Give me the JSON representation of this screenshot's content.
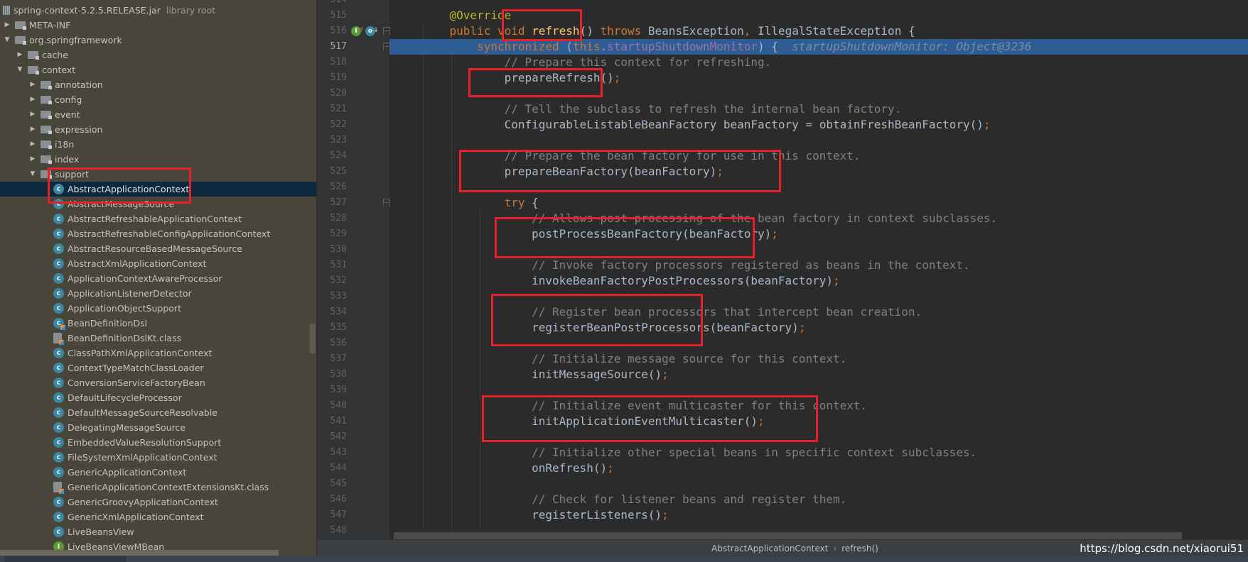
{
  "project_tree": {
    "root": {
      "label": "spring-context-5.2.5.RELEASE.jar",
      "sublabel": "library root",
      "icon": "jar-icon"
    },
    "items": [
      {
        "label": "META-INF",
        "depth": 0,
        "type": "folder",
        "expanded": false
      },
      {
        "label": "org.springframework",
        "depth": 0,
        "type": "folder",
        "expanded": true
      },
      {
        "label": "cache",
        "depth": 1,
        "type": "folder",
        "expanded": false
      },
      {
        "label": "context",
        "depth": 1,
        "type": "folder",
        "expanded": true
      },
      {
        "label": "annotation",
        "depth": 2,
        "type": "folder",
        "expanded": false
      },
      {
        "label": "config",
        "depth": 2,
        "type": "folder",
        "expanded": false
      },
      {
        "label": "event",
        "depth": 2,
        "type": "folder",
        "expanded": false
      },
      {
        "label": "expression",
        "depth": 2,
        "type": "folder",
        "expanded": false
      },
      {
        "label": "i18n",
        "depth": 2,
        "type": "folder",
        "expanded": false
      },
      {
        "label": "index",
        "depth": 2,
        "type": "folder",
        "expanded": false
      },
      {
        "label": "support",
        "depth": 2,
        "type": "folder",
        "expanded": true
      },
      {
        "label": "AbstractApplicationContext",
        "depth": 3,
        "type": "class",
        "selected": true
      },
      {
        "label": "AbstractMessageSource",
        "depth": 3,
        "type": "class"
      },
      {
        "label": "AbstractRefreshableApplicationContext",
        "depth": 3,
        "type": "class"
      },
      {
        "label": "AbstractRefreshableConfigApplicationContext",
        "depth": 3,
        "type": "class"
      },
      {
        "label": "AbstractResourceBasedMessageSource",
        "depth": 3,
        "type": "class"
      },
      {
        "label": "AbstractXmlApplicationContext",
        "depth": 3,
        "type": "class"
      },
      {
        "label": "ApplicationContextAwareProcessor",
        "depth": 3,
        "type": "class"
      },
      {
        "label": "ApplicationListenerDetector",
        "depth": 3,
        "type": "class"
      },
      {
        "label": "ApplicationObjectSupport",
        "depth": 3,
        "type": "class"
      },
      {
        "label": "BeanDefinitionDsl",
        "depth": 3,
        "type": "kotlin-class"
      },
      {
        "label": "BeanDefinitionDslKt.class",
        "depth": 3,
        "type": "kotlin-file"
      },
      {
        "label": "ClassPathXmlApplicationContext",
        "depth": 3,
        "type": "class"
      },
      {
        "label": "ContextTypeMatchClassLoader",
        "depth": 3,
        "type": "class"
      },
      {
        "label": "ConversionServiceFactoryBean",
        "depth": 3,
        "type": "class"
      },
      {
        "label": "DefaultLifecycleProcessor",
        "depth": 3,
        "type": "class"
      },
      {
        "label": "DefaultMessageSourceResolvable",
        "depth": 3,
        "type": "class"
      },
      {
        "label": "DelegatingMessageSource",
        "depth": 3,
        "type": "class"
      },
      {
        "label": "EmbeddedValueResolutionSupport",
        "depth": 3,
        "type": "class"
      },
      {
        "label": "FileSystemXmlApplicationContext",
        "depth": 3,
        "type": "class"
      },
      {
        "label": "GenericApplicationContext",
        "depth": 3,
        "type": "class"
      },
      {
        "label": "GenericApplicationContextExtensionsKt.class",
        "depth": 3,
        "type": "kotlin-file"
      },
      {
        "label": "GenericGroovyApplicationContext",
        "depth": 3,
        "type": "class"
      },
      {
        "label": "GenericXmlApplicationContext",
        "depth": 3,
        "type": "class"
      },
      {
        "label": "LiveBeansView",
        "depth": 3,
        "type": "class"
      },
      {
        "label": "LiveBeansViewMBean",
        "depth": 3,
        "type": "interface"
      }
    ]
  },
  "editor": {
    "partial_top_line": "514",
    "current_line": "517",
    "lines": [
      {
        "num": "515",
        "tokens": [
          {
            "t": "    ",
            "c": "plain"
          },
          {
            "t": "@Override",
            "c": "ann"
          }
        ]
      },
      {
        "num": "516",
        "tokens": [
          {
            "t": "    ",
            "c": "plain"
          },
          {
            "t": "public void ",
            "c": "kw"
          },
          {
            "t": "refresh",
            "c": "fn"
          },
          {
            "t": "() ",
            "c": "plain"
          },
          {
            "t": "throws ",
            "c": "kw"
          },
          {
            "t": "BeansException",
            "c": "plain"
          },
          {
            "t": ", ",
            "c": "kw"
          },
          {
            "t": "IllegalStateException {",
            "c": "plain"
          }
        ]
      },
      {
        "num": "517",
        "tokens": [
          {
            "t": "        ",
            "c": "plain"
          },
          {
            "t": "synchronized ",
            "c": "kw"
          },
          {
            "t": "(",
            "c": "plain"
          },
          {
            "t": "this",
            "c": "kw"
          },
          {
            "t": ".",
            "c": "plain"
          },
          {
            "t": "startupShutdownMonitor",
            "c": "field"
          },
          {
            "t": ") {  ",
            "c": "plain"
          },
          {
            "t": "startupShutdownMonitor: Object@3236",
            "c": "hint"
          }
        ]
      },
      {
        "num": "518",
        "tokens": [
          {
            "t": "            ",
            "c": "plain"
          },
          {
            "t": "// Prepare this context for refreshing.",
            "c": "cm"
          }
        ]
      },
      {
        "num": "519",
        "tokens": [
          {
            "t": "            prepareRefresh()",
            "c": "plain"
          },
          {
            "t": ";",
            "c": "semi"
          }
        ]
      },
      {
        "num": "520",
        "tokens": []
      },
      {
        "num": "521",
        "tokens": [
          {
            "t": "            ",
            "c": "plain"
          },
          {
            "t": "// Tell the subclass to refresh the internal bean factory.",
            "c": "cm"
          }
        ]
      },
      {
        "num": "522",
        "tokens": [
          {
            "t": "            ConfigurableListableBeanFactory beanFactory = obtainFreshBeanFactory()",
            "c": "plain"
          },
          {
            "t": ";",
            "c": "semi"
          }
        ]
      },
      {
        "num": "523",
        "tokens": []
      },
      {
        "num": "524",
        "tokens": [
          {
            "t": "            ",
            "c": "plain"
          },
          {
            "t": "// Prepare the bean factory for use in this context.",
            "c": "cm"
          }
        ]
      },
      {
        "num": "525",
        "tokens": [
          {
            "t": "            prepareBeanFactory(beanFactory)",
            "c": "plain"
          },
          {
            "t": ";",
            "c": "semi"
          }
        ]
      },
      {
        "num": "526",
        "tokens": []
      },
      {
        "num": "527",
        "tokens": [
          {
            "t": "            ",
            "c": "plain"
          },
          {
            "t": "try ",
            "c": "kw"
          },
          {
            "t": "{",
            "c": "plain"
          }
        ]
      },
      {
        "num": "528",
        "tokens": [
          {
            "t": "                ",
            "c": "plain"
          },
          {
            "t": "// Allows post-processing of the bean factory in context subclasses.",
            "c": "cm"
          }
        ]
      },
      {
        "num": "529",
        "tokens": [
          {
            "t": "                postProcessBeanFactory(beanFactory)",
            "c": "plain"
          },
          {
            "t": ";",
            "c": "semi"
          }
        ]
      },
      {
        "num": "530",
        "tokens": []
      },
      {
        "num": "531",
        "tokens": [
          {
            "t": "                ",
            "c": "plain"
          },
          {
            "t": "// Invoke factory processors registered as beans in the context.",
            "c": "cm"
          }
        ]
      },
      {
        "num": "532",
        "tokens": [
          {
            "t": "                invokeBeanFactoryPostProcessors(beanFactory)",
            "c": "plain"
          },
          {
            "t": ";",
            "c": "semi"
          }
        ]
      },
      {
        "num": "533",
        "tokens": []
      },
      {
        "num": "534",
        "tokens": [
          {
            "t": "                ",
            "c": "plain"
          },
          {
            "t": "// Register bean processors that intercept bean creation.",
            "c": "cm"
          }
        ]
      },
      {
        "num": "535",
        "tokens": [
          {
            "t": "                registerBeanPostProcessors(beanFactory)",
            "c": "plain"
          },
          {
            "t": ";",
            "c": "semi"
          }
        ]
      },
      {
        "num": "536",
        "tokens": []
      },
      {
        "num": "537",
        "tokens": [
          {
            "t": "                ",
            "c": "plain"
          },
          {
            "t": "// Initialize message source for this context.",
            "c": "cm"
          }
        ]
      },
      {
        "num": "538",
        "tokens": [
          {
            "t": "                initMessageSource()",
            "c": "plain"
          },
          {
            "t": ";",
            "c": "semi"
          }
        ]
      },
      {
        "num": "539",
        "tokens": []
      },
      {
        "num": "540",
        "tokens": [
          {
            "t": "                ",
            "c": "plain"
          },
          {
            "t": "// Initialize event multicaster for this context.",
            "c": "cm"
          }
        ]
      },
      {
        "num": "541",
        "tokens": [
          {
            "t": "                initApplicationEventMulticaster()",
            "c": "plain"
          },
          {
            "t": ";",
            "c": "semi"
          }
        ]
      },
      {
        "num": "542",
        "tokens": []
      },
      {
        "num": "543",
        "tokens": [
          {
            "t": "                ",
            "c": "plain"
          },
          {
            "t": "// Initialize other special beans in specific context subclasses.",
            "c": "cm"
          }
        ]
      },
      {
        "num": "544",
        "tokens": [
          {
            "t": "                onRefresh()",
            "c": "plain"
          },
          {
            "t": ";",
            "c": "semi"
          }
        ]
      },
      {
        "num": "545",
        "tokens": []
      },
      {
        "num": "546",
        "tokens": [
          {
            "t": "                ",
            "c": "plain"
          },
          {
            "t": "// Check for listener beans and register them.",
            "c": "cm"
          }
        ]
      },
      {
        "num": "547",
        "tokens": [
          {
            "t": "                registerListeners()",
            "c": "plain"
          },
          {
            "t": ";",
            "c": "semi"
          }
        ]
      },
      {
        "num": "548",
        "tokens": []
      }
    ],
    "gutter_icons": [
      {
        "name": "implements-interface-icon",
        "glyph": "I",
        "color": "#5e9a3a",
        "arrow": "↑",
        "arrow_color": "#d04a4a"
      },
      {
        "name": "overridden-method-icon",
        "glyph": "o",
        "color": "#3e86a0",
        "arrow": "↓",
        "arrow_color": "#bbbbbb"
      }
    ]
  },
  "breadcrumb": {
    "items": [
      "AbstractApplicationContext",
      "refresh()"
    ],
    "separator": "›"
  },
  "watermark": "https://blog.csdn.net/xiaorui51",
  "colors": {
    "highlight": "#e8202a",
    "current_line": "#2d5d94",
    "selection": "#0d293e",
    "keyword": "#cc7832",
    "annotation": "#bbb529",
    "method": "#ffc66d",
    "field": "#9876aa",
    "comment": "#808080"
  }
}
